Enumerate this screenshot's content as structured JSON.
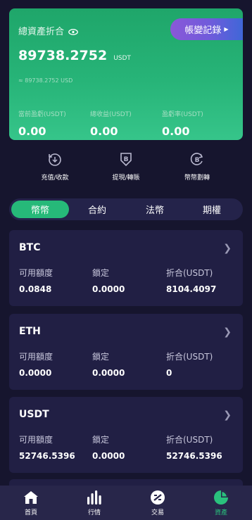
{
  "summary": {
    "title": "總資產折合",
    "ledger_button": "帳變記錄",
    "total_value": "89738.2752",
    "total_unit": "USDT",
    "approx_usd": "≈ 89738.2752 USD",
    "stats": [
      {
        "label": "當前盈虧(USDT)",
        "value": "0.00"
      },
      {
        "label": "總收益(USDT)",
        "value": "0.00"
      },
      {
        "label": "盈虧率(USDT)",
        "value": "0.00"
      }
    ]
  },
  "actions": [
    {
      "label": "充值/收款",
      "icon": "deposit-icon"
    },
    {
      "label": "提現/轉賬",
      "icon": "withdraw-icon"
    },
    {
      "label": "幣幣劃轉",
      "icon": "transfer-icon"
    }
  ],
  "tabs": [
    {
      "label": "幣幣",
      "active": true
    },
    {
      "label": "合約",
      "active": false
    },
    {
      "label": "法幣",
      "active": false
    },
    {
      "label": "期權",
      "active": false
    }
  ],
  "columns": {
    "available": "可用額度",
    "locked": "鎖定",
    "converted": "折合(USDT)"
  },
  "assets": [
    {
      "coin": "BTC",
      "available": "0.0848",
      "locked": "0.0000",
      "converted": "8104.4097"
    },
    {
      "coin": "ETH",
      "available": "0.0000",
      "locked": "0.0000",
      "converted": "0"
    },
    {
      "coin": "USDT",
      "available": "52746.5396",
      "locked": "0.0000",
      "converted": "52746.5396"
    }
  ],
  "nav": [
    {
      "label": "首頁",
      "icon": "home-icon",
      "active": false
    },
    {
      "label": "行情",
      "icon": "market-bars-icon",
      "active": false
    },
    {
      "label": "交易",
      "icon": "trade-icon",
      "active": false
    },
    {
      "label": "資產",
      "icon": "assets-pie-icon",
      "active": true
    }
  ],
  "colors": {
    "accent_green": "#26b979",
    "background": "#16152e",
    "card": "#211f44",
    "ledger_gradient_start": "#8a58d8",
    "ledger_gradient_end": "#3f67d8"
  }
}
